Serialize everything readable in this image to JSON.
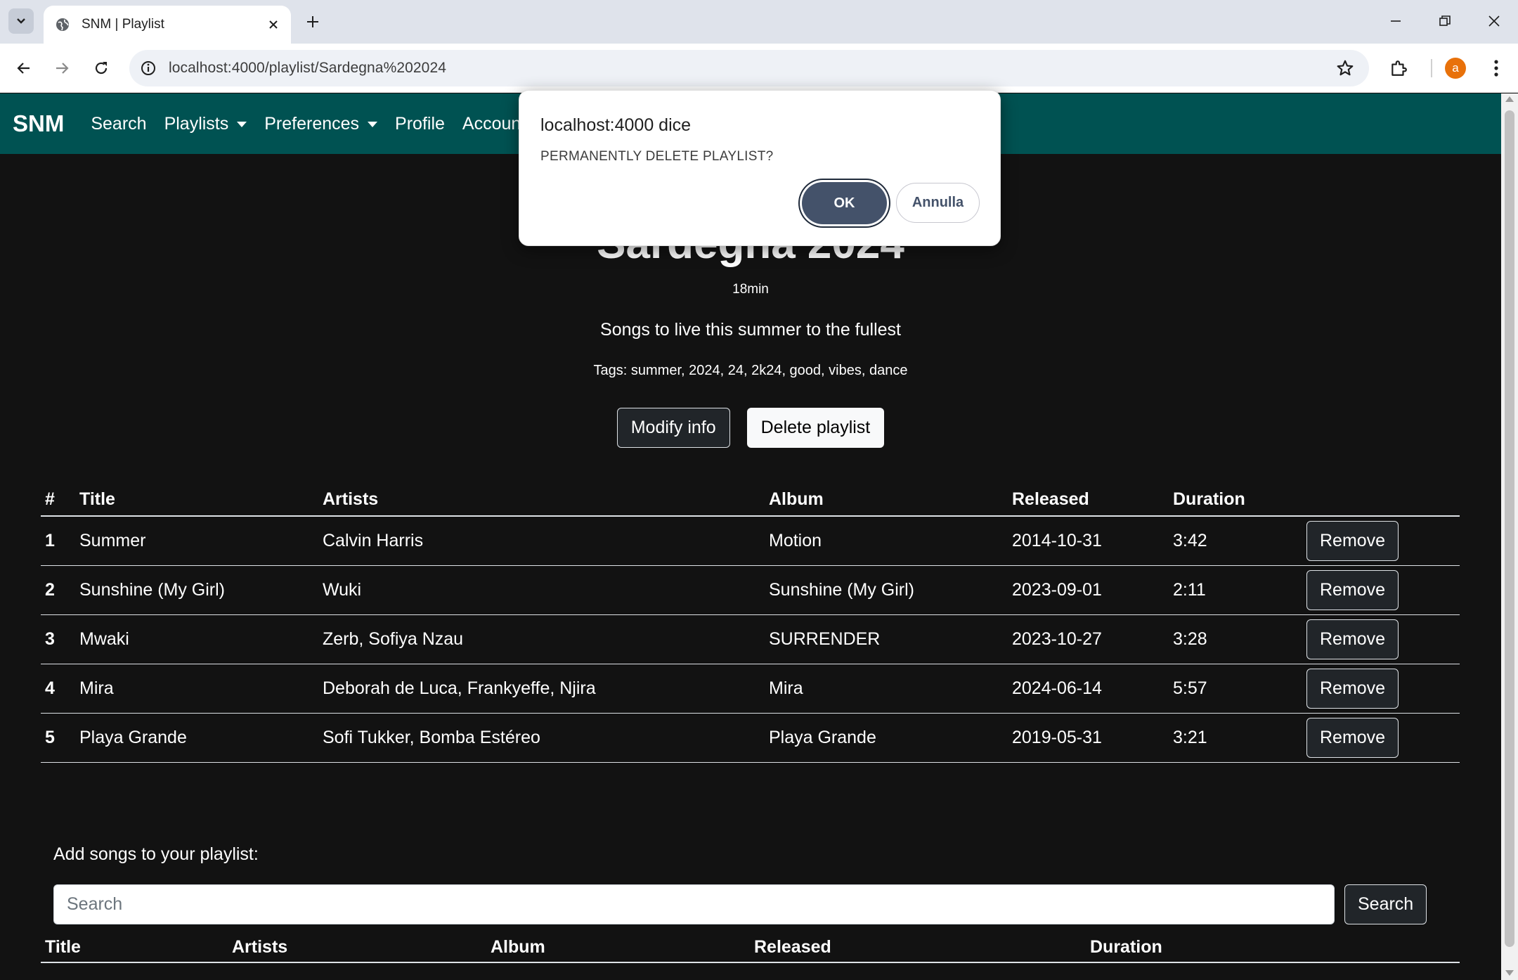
{
  "browser": {
    "tab_title": "SNM | Playlist",
    "url": "localhost:4000/playlist/Sardegna%202024",
    "profile_initial": "a"
  },
  "navbar": {
    "brand": "SNM",
    "links": {
      "search": "Search",
      "playlists": "Playlists",
      "preferences": "Preferences",
      "profile": "Profile",
      "account": "Account"
    }
  },
  "playlist": {
    "title": "Sardegna 2024",
    "duration": "18min",
    "description": "Songs to live this summer to the fullest",
    "tags": "Tags: summer, 2024, 24, 2k24, good, vibes, dance",
    "modify_label": "Modify info",
    "delete_label": "Delete playlist"
  },
  "songs_table": {
    "headers": {
      "num": "#",
      "title": "Title",
      "artists": "Artists",
      "album": "Album",
      "released": "Released",
      "duration": "Duration"
    },
    "remove_label": "Remove",
    "rows": [
      {
        "num": "1",
        "title": "Summer",
        "artists": "Calvin Harris",
        "album": "Motion",
        "released": "2014-10-31",
        "duration": "3:42"
      },
      {
        "num": "2",
        "title": "Sunshine (My Girl)",
        "artists": "Wuki",
        "album": "Sunshine (My Girl)",
        "released": "2023-09-01",
        "duration": "2:11"
      },
      {
        "num": "3",
        "title": "Mwaki",
        "artists": "Zerb, Sofiya Nzau",
        "album": "SURRENDER",
        "released": "2023-10-27",
        "duration": "3:28"
      },
      {
        "num": "4",
        "title": "Mira",
        "artists": "Deborah de Luca, Frankyeffe, Njira",
        "album": "Mira",
        "released": "2024-06-14",
        "duration": "5:57"
      },
      {
        "num": "5",
        "title": "Playa Grande",
        "artists": "Sofi Tukker, Bomba Estéreo",
        "album": "Playa Grande",
        "released": "2019-05-31",
        "duration": "3:21"
      }
    ]
  },
  "add_songs": {
    "label": "Add songs to your playlist:",
    "search_placeholder": "Search",
    "search_button": "Search",
    "headers": {
      "title": "Title",
      "artists": "Artists",
      "album": "Album",
      "released": "Released",
      "duration": "Duration"
    }
  },
  "dialog": {
    "title": "localhost:4000 dice",
    "message": "PERMANENTLY DELETE PLAYLIST?",
    "ok_label": "OK",
    "cancel_label": "Annulla"
  },
  "colors": {
    "navbar": "#005252",
    "page_background": "#121212",
    "dialog_ok": "#44526a"
  }
}
